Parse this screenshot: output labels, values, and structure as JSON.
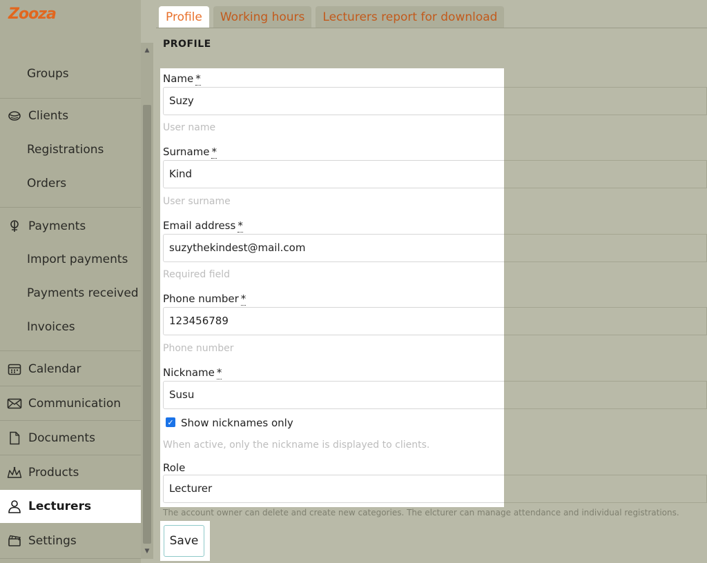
{
  "app": {
    "logo_text": "Zooza",
    "brand_color": "#e2661e"
  },
  "sidebar": {
    "items": [
      {
        "label": "Groups",
        "icon": ""
      },
      {
        "label": "Clients",
        "icon": "clients-icon"
      },
      {
        "label": "Registrations",
        "icon": ""
      },
      {
        "label": "Orders",
        "icon": ""
      },
      {
        "label": "Payments",
        "icon": "payments-icon"
      },
      {
        "label": "Import payments",
        "icon": ""
      },
      {
        "label": "Payments received",
        "icon": ""
      },
      {
        "label": "Invoices",
        "icon": ""
      },
      {
        "label": "Calendar",
        "icon": "calendar-icon"
      },
      {
        "label": "Communication",
        "icon": "envelope-icon"
      },
      {
        "label": "Documents",
        "icon": "document-icon"
      },
      {
        "label": "Products",
        "icon": "products-icon"
      },
      {
        "label": "Lecturers",
        "icon": "person-icon",
        "active": true
      },
      {
        "label": "Settings",
        "icon": "settings-icon"
      }
    ]
  },
  "tabs": [
    {
      "label": "Profile",
      "active": true
    },
    {
      "label": "Working hours"
    },
    {
      "label": "Lecturers report for download"
    }
  ],
  "section_title": "PROFILE",
  "form": {
    "name": {
      "label": "Name",
      "required_mark": "*",
      "value": "Suzy",
      "hint": "User name"
    },
    "surname": {
      "label": "Surname",
      "required_mark": "*",
      "value": "Kind",
      "hint": "User surname"
    },
    "email": {
      "label": "Email address",
      "required_mark": "*",
      "value": "suzythekindest@mail.com",
      "hint": "Required field"
    },
    "phone": {
      "label": "Phone number",
      "required_mark": "*",
      "value": "123456789",
      "hint": "Phone number"
    },
    "nickname": {
      "label": "Nickname",
      "required_mark": "*",
      "value": "Susu"
    },
    "show_nicknames": {
      "label": "Show nicknames only",
      "checked": true,
      "hint": "When active, only the nickname is displayed to clients."
    },
    "role": {
      "label": "Role",
      "value": "Lecturer",
      "hint": "The account owner can delete and create new categories. The elcturer can manage attendance and individual registrations."
    }
  },
  "save_label": "Save"
}
